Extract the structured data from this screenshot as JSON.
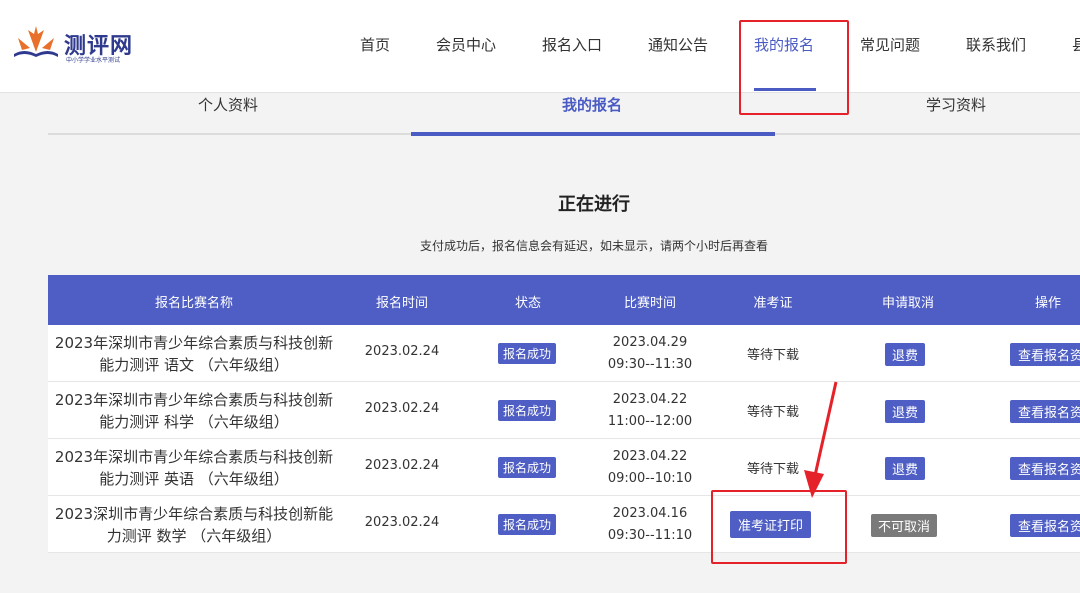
{
  "header": {
    "logo_text": "测评网",
    "logo_sub": "中小学学业水平测试",
    "nav": [
      "首页",
      "会员中心",
      "报名入口",
      "通知公告",
      "我的报名",
      "常见问题",
      "联系我们",
      "县"
    ]
  },
  "subtabs": [
    "个人资料",
    "我的报名",
    "学习资料"
  ],
  "section": {
    "title": "正在进行",
    "notice": "支付成功后，报名信息会有延迟，如未显示，请两个小时后再查看"
  },
  "table": {
    "columns": [
      "报名比赛名称",
      "报名时间",
      "状态",
      "比赛时间",
      "准考证",
      "申请取消",
      "操作"
    ],
    "rows": [
      {
        "name": "2023年深圳市青少年综合素质与科技创新能力测评 语文 （六年级组）",
        "reg_time": "2023.02.24",
        "status": "报名成功",
        "date": "2023.04.29",
        "time": "09:30--11:30",
        "ticket": "等待下载",
        "cancel": "退费",
        "action": "查看报名资"
      },
      {
        "name": "2023年深圳市青少年综合素质与科技创新能力测评 科学 （六年级组）",
        "reg_time": "2023.02.24",
        "status": "报名成功",
        "date": "2023.04.22",
        "time": "11:00--12:00",
        "ticket": "等待下载",
        "cancel": "退费",
        "action": "查看报名资"
      },
      {
        "name": "2023年深圳市青少年综合素质与科技创新能力测评 英语 （六年级组）",
        "reg_time": "2023.02.24",
        "status": "报名成功",
        "date": "2023.04.22",
        "time": "09:00--10:10",
        "ticket": "等待下载",
        "cancel": "退费",
        "action": "查看报名资"
      },
      {
        "name": "2023深圳市青少年综合素质与科技创新能力测评 数学 （六年级组）",
        "reg_time": "2023.02.24",
        "status": "报名成功",
        "date": "2023.04.16",
        "time": "09:30--11:10",
        "ticket": "准考证打印",
        "cancel": "不可取消",
        "action": "查看报名资"
      }
    ]
  },
  "colors": {
    "accent": "#4e5ec4",
    "highlight": "#e5212a",
    "disabled": "#7a7a7a"
  }
}
